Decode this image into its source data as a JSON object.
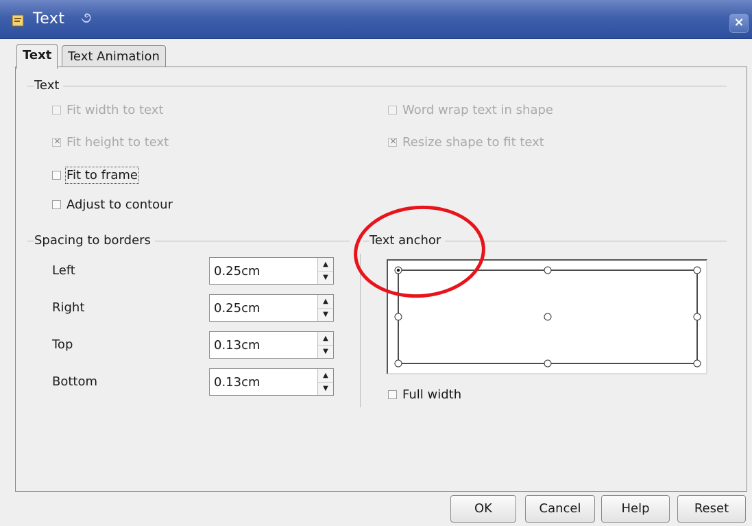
{
  "window": {
    "title": "Text",
    "icon": "document-app-icon",
    "close_label": "×"
  },
  "tabs": [
    {
      "label": "Text",
      "active": true
    },
    {
      "label": "Text Animation",
      "active": false
    }
  ],
  "text_section": {
    "heading": "Text",
    "checkboxes": [
      {
        "label": "Fit width to text",
        "checked": false,
        "enabled": false
      },
      {
        "label": "Fit height to text",
        "checked": true,
        "enabled": false
      },
      {
        "label": "Fit to frame",
        "checked": false,
        "enabled": true
      },
      {
        "label": "Adjust to contour",
        "checked": false,
        "enabled": true
      },
      {
        "label": "Word wrap text in shape",
        "checked": false,
        "enabled": false
      },
      {
        "label": "Resize shape to fit text",
        "checked": true,
        "enabled": false
      }
    ]
  },
  "spacing_section": {
    "heading": "Spacing to borders",
    "fields": [
      {
        "label": "Left",
        "value": "0.25cm"
      },
      {
        "label": "Right",
        "value": "0.25cm"
      },
      {
        "label": "Top",
        "value": "0.13cm"
      },
      {
        "label": "Bottom",
        "value": "0.13cm"
      }
    ]
  },
  "anchor_section": {
    "heading": "Text anchor",
    "selected_position": "top-left",
    "full_width_label": "Full width",
    "full_width_checked": false
  },
  "buttons": {
    "ok": "OK",
    "cancel": "Cancel",
    "help": "Help",
    "reset": "Reset"
  },
  "colors": {
    "titlebar": "#3f60ac",
    "annotation": "#e8141c"
  }
}
